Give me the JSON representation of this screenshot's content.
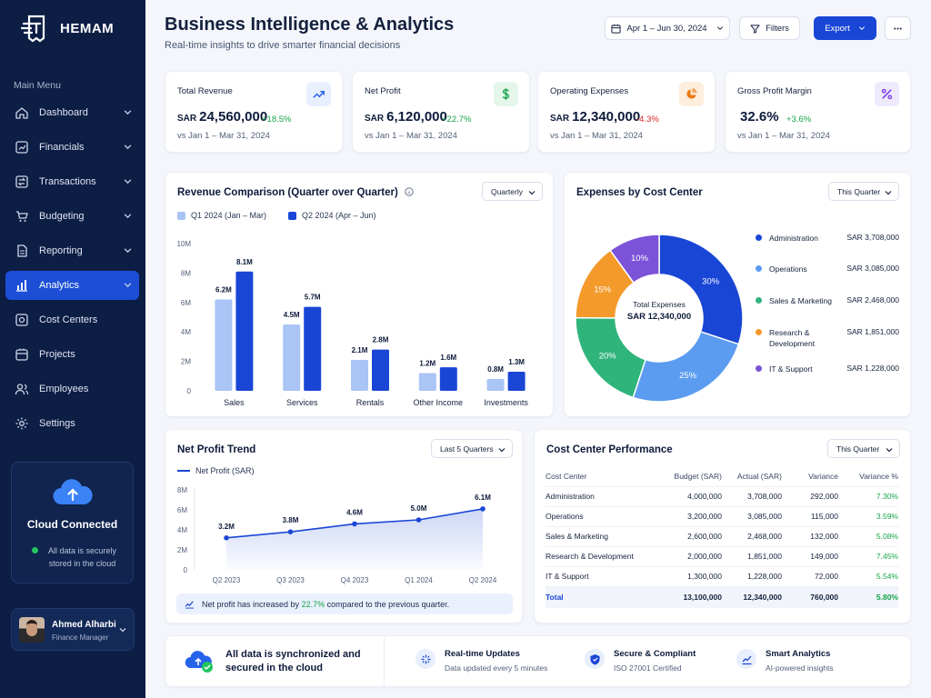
{
  "brand": {
    "name": "HEMAM"
  },
  "sidebar": {
    "menu_title": "Main Menu",
    "items": [
      {
        "label": "Dashboard",
        "icon": "home-icon",
        "chevron": true
      },
      {
        "label": "Financials",
        "icon": "financials-icon",
        "chevron": true
      },
      {
        "label": "Transactions",
        "icon": "transactions-icon",
        "chevron": true
      },
      {
        "label": "Budgeting",
        "icon": "budgeting-icon",
        "chevron": true
      },
      {
        "label": "Reporting",
        "icon": "reporting-icon",
        "chevron": true
      },
      {
        "label": "Analytics",
        "icon": "analytics-icon",
        "chevron": true,
        "active": true
      },
      {
        "label": "Cost Centers",
        "icon": "cost-centers-icon"
      },
      {
        "label": "Projects",
        "icon": "projects-icon"
      },
      {
        "label": "Employees",
        "icon": "employees-icon"
      },
      {
        "label": "Settings",
        "icon": "settings-icon"
      }
    ],
    "cloud": {
      "title": "Cloud Connected",
      "status": "All data is securely stored in the cloud"
    },
    "user": {
      "name": "Ahmed Alharbi",
      "role": "Finance Manager"
    }
  },
  "header": {
    "title": "Business Intelligence & Analytics",
    "subtitle": "Real-time insights to drive smarter financial decisions",
    "date_range": "Apr 1 – Jun 30, 2024",
    "filters_label": "Filters",
    "export_label": "Export"
  },
  "kpis": [
    {
      "label": "Total Revenue",
      "currency": "SAR",
      "value": "24,560,000",
      "delta": "+18.5%",
      "trend": "up",
      "sub": "vs Jan 1 – Mar 31, 2024",
      "icon": "trend-chart-icon",
      "icon_color": "#2563eb",
      "icon_bg": "#e8effd"
    },
    {
      "label": "Net Profit",
      "currency": "SAR",
      "value": "6,120,000",
      "delta": "+22.7%",
      "trend": "up",
      "sub": "vs Jan 1 – Mar 31, 2024",
      "icon": "dollar-icon",
      "icon_color": "#16a34a",
      "icon_bg": "#e4f6ea"
    },
    {
      "label": "Operating Expenses",
      "currency": "SAR",
      "value": "12,340,000",
      "delta": "-4.3%",
      "trend": "down",
      "sub": "vs Jan 1 – Mar 31, 2024",
      "icon": "pie-icon",
      "icon_color": "#ea7a12",
      "icon_bg": "#fdeedd"
    },
    {
      "label": "Gross Profit Margin",
      "currency": "",
      "value": "32.6%",
      "delta": "+3.6%",
      "trend": "up",
      "sub": "vs Jan 1 – Mar 31, 2024",
      "icon": "percent-icon",
      "icon_color": "#7c3aed",
      "icon_bg": "#efe9fc"
    }
  ],
  "revenue_card": {
    "title": "Revenue Comparison (Quarter over Quarter)",
    "period_select": "Quarterly"
  },
  "expenses_card": {
    "title": "Expenses by Cost Center",
    "period_select": "This Quarter",
    "center_title": "Total Expenses",
    "center_value": "SAR 12,340,000"
  },
  "profit_card": {
    "title": "Net Profit Trend",
    "period_select": "Last 5 Quarters",
    "note_prefix": "Net profit has increased by ",
    "note_value": "22.7%",
    "note_suffix": " compared to the previous quarter."
  },
  "performance_card": {
    "title": "Cost Center Performance",
    "period_select": "This Quarter",
    "columns": [
      "Cost Center",
      "Budget (SAR)",
      "Actual (SAR)",
      "Variance",
      "Variance %"
    ],
    "rows": [
      [
        "Administration",
        "4,000,000",
        "3,708,000",
        "292,000",
        "7.30%"
      ],
      [
        "Operations",
        "3,200,000",
        "3,085,000",
        "115,000",
        "3.59%"
      ],
      [
        "Sales & Marketing",
        "2,600,000",
        "2,468,000",
        "132,000",
        "5.08%"
      ],
      [
        "Research & Development",
        "2,000,000",
        "1,851,000",
        "149,000",
        "7.45%"
      ],
      [
        "IT & Support",
        "1,300,000",
        "1,228,000",
        "72,000",
        "5.54%"
      ]
    ],
    "total": [
      "Total",
      "13,100,000",
      "12,340,000",
      "760,000",
      "5.80%"
    ]
  },
  "footer": {
    "main": "All data is synchronized and secured in the cloud",
    "items": [
      {
        "title": "Real-time Updates",
        "sub": "Data updated every 5 minutes",
        "icon": "sparkle-icon"
      },
      {
        "title": "Secure & Compliant",
        "sub": "ISO 27001 Certified",
        "icon": "shield-icon"
      },
      {
        "title": "Smart Analytics",
        "sub": "AI-powered insights",
        "icon": "analytics-icon"
      }
    ]
  },
  "chart_data": [
    {
      "type": "bar",
      "title": "Revenue Comparison (Quarter over Quarter)",
      "categories": [
        "Sales",
        "Services",
        "Rentals",
        "Other Income",
        "Investments"
      ],
      "series": [
        {
          "name": "Q1 2024 (Jan – Mar)",
          "values": [
            6.2,
            4.5,
            2.1,
            1.2,
            0.8
          ],
          "labels": [
            "6.2M",
            "4.5M",
            "2.1M",
            "1.2M",
            "0.8M"
          ],
          "color": "#a9c4f5"
        },
        {
          "name": "Q2 2024 (Apr – Jun)",
          "values": [
            8.1,
            5.7,
            2.8,
            1.6,
            1.3
          ],
          "labels": [
            "8.1M",
            "5.7M",
            "2.8M",
            "1.6M",
            "1.3M"
          ],
          "color": "#1a46d6"
        }
      ],
      "ylim": [
        0,
        10
      ],
      "yticks": [
        "0",
        "2M",
        "4M",
        "6M",
        "8M",
        "10M"
      ]
    },
    {
      "type": "pie",
      "title": "Expenses by Cost Center",
      "slices": [
        {
          "name": "Administration",
          "value": 3708000,
          "label": "30%",
          "amount": "SAR 3,708,000",
          "color": "#1a46d6"
        },
        {
          "name": "Operations",
          "value": 3085000,
          "label": "25%",
          "amount": "SAR 3,085,000",
          "color": "#5b9cf0"
        },
        {
          "name": "Sales & Marketing",
          "value": 2468000,
          "label": "20%",
          "amount": "SAR 2,468,000",
          "color": "#2fb47c"
        },
        {
          "name": "Research & Development",
          "value": 1851000,
          "label": "15%",
          "amount": "SAR 1,851,000",
          "color": "#f39a2b"
        },
        {
          "name": "IT & Support",
          "value": 1228000,
          "label": "10%",
          "amount": "SAR 1,228,000",
          "color": "#7b52d8"
        }
      ]
    },
    {
      "type": "line",
      "title": "Net Profit Trend",
      "series": [
        {
          "name": "Net Profit (SAR)",
          "values": [
            3.2,
            3.8,
            4.6,
            5.0,
            6.1
          ],
          "labels": [
            "3.2M",
            "3.8M",
            "4.6M",
            "5.0M",
            "6.1M"
          ],
          "color": "#1a46d6"
        }
      ],
      "x": [
        "Q2 2023",
        "Q3 2023",
        "Q4 2023",
        "Q1 2024",
        "Q2 2024"
      ],
      "ylim": [
        0,
        8
      ],
      "yticks": [
        "0",
        "2M",
        "4M",
        "6M",
        "8M"
      ]
    }
  ]
}
